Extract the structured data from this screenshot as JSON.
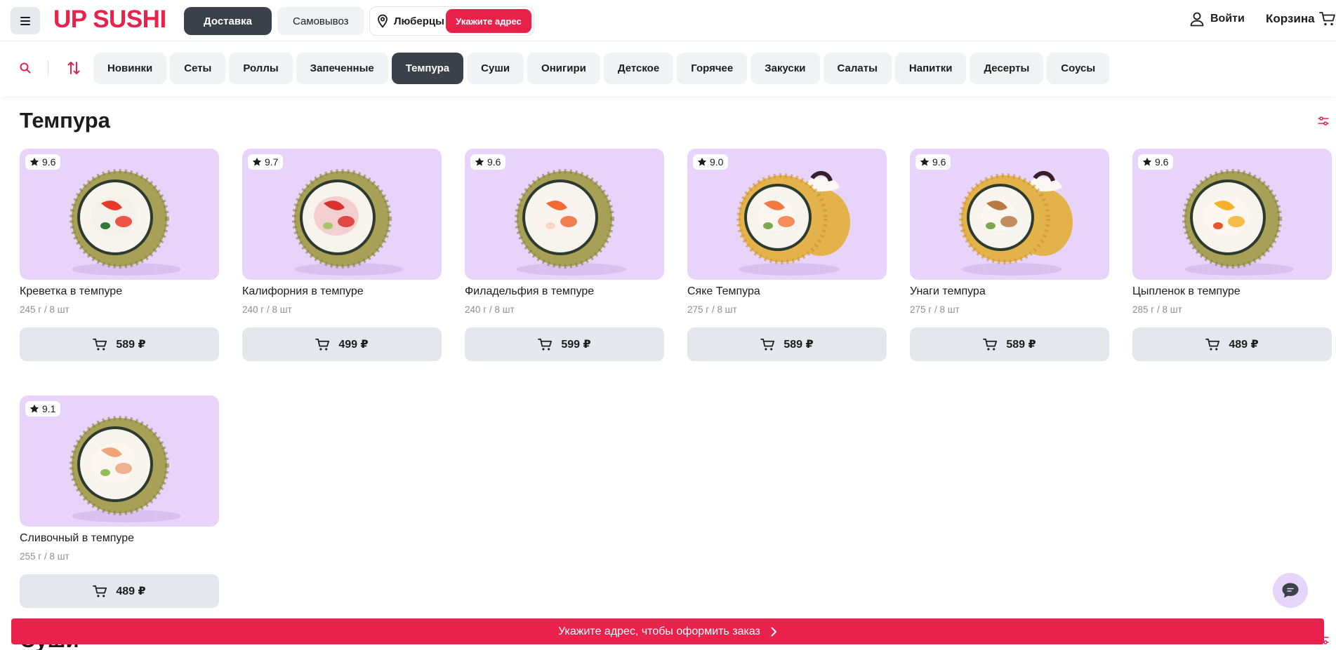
{
  "header": {
    "logo_text": "UP SUSHI",
    "delivery_label": "Доставка",
    "pickup_label": "Самовывоз",
    "city": "Люберцы",
    "address_button": "Укажите адрес",
    "login_label": "Войти",
    "cart_label": "Корзина"
  },
  "categories": [
    {
      "label": "Новинки",
      "active": false
    },
    {
      "label": "Сеты",
      "active": false
    },
    {
      "label": "Роллы",
      "active": false
    },
    {
      "label": "Запеченные",
      "active": false
    },
    {
      "label": "Темпура",
      "active": true
    },
    {
      "label": "Суши",
      "active": false
    },
    {
      "label": "Онигири",
      "active": false
    },
    {
      "label": "Детское",
      "active": false
    },
    {
      "label": "Горячее",
      "active": false
    },
    {
      "label": "Закуски",
      "active": false
    },
    {
      "label": "Салаты",
      "active": false
    },
    {
      "label": "Напитки",
      "active": false
    },
    {
      "label": "Десерты",
      "active": false
    },
    {
      "label": "Соусы",
      "active": false
    }
  ],
  "section": {
    "title": "Темпура",
    "next_title": "Суши"
  },
  "products": [
    {
      "rating": "9.6",
      "name": "Креветка в темпуре",
      "weight": "245 г / 8 шт",
      "price": "589 ₽",
      "image": "shrimp-tempura-roll"
    },
    {
      "rating": "9.7",
      "name": "Калифорния в темпуре",
      "weight": "240 г / 8 шт",
      "price": "499 ₽",
      "image": "california-tempura-roll"
    },
    {
      "rating": "9.6",
      "name": "Филадельфия в темпуре",
      "weight": "240 г / 8 шт",
      "price": "599 ₽",
      "image": "philadelphia-tempura-roll"
    },
    {
      "rating": "9.0",
      "name": "Сяке Темпура",
      "weight": "275 г / 8 шт",
      "price": "589 ₽",
      "image": "syake-tempura-roll"
    },
    {
      "rating": "9.6",
      "name": "Унаги темпура",
      "weight": "275 г / 8 шт",
      "price": "589 ₽",
      "image": "unagi-tempura-roll"
    },
    {
      "rating": "9.6",
      "name": "Цыпленок в темпуре",
      "weight": "285 г / 8 шт",
      "price": "489 ₽",
      "image": "chicken-tempura-roll"
    },
    {
      "rating": "9.1",
      "name": "Сливочный в темпуре",
      "weight": "255 г / 8 шт",
      "price": "489 ₽",
      "image": "creamy-tempura-roll"
    }
  ],
  "bottom_bar": {
    "label": "Укажите адрес, чтобы оформить заказ"
  },
  "colors": {
    "brand": "#e8224a",
    "dark_button": "#3b4148",
    "card_background": "#e8d4fb",
    "price_button": "#e4e7ec"
  }
}
